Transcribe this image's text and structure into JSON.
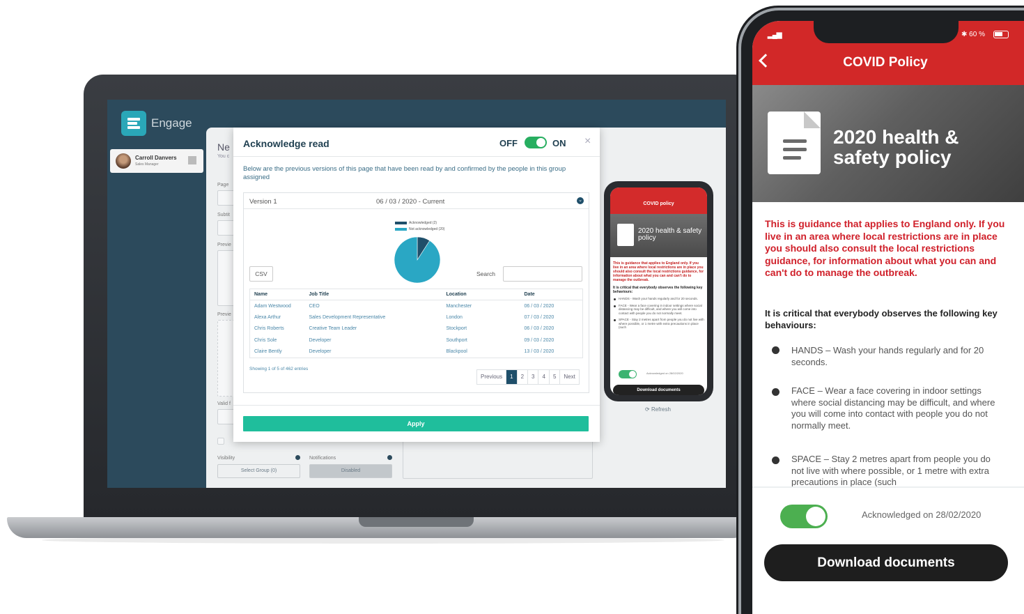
{
  "app": {
    "logo_text": "Engage",
    "user_name": "Carroll Danvers",
    "user_role": "Sales Manager",
    "bg_title": "Ne",
    "bg_sub": "You c",
    "bg_labels": [
      "Page",
      "Subtit",
      "Previe",
      "Previe",
      "Valid f"
    ],
    "visibility_label": "Visibility",
    "visibility_value": "Select Group (0)",
    "notifications_label": "Notifications",
    "notifications_value": "Disabled",
    "refresh_label": "Refresh"
  },
  "modal": {
    "title": "Acknowledge read",
    "toggle_off": "OFF",
    "toggle_on": "ON",
    "toggle_state": "on",
    "close": "×",
    "description": "Below are the previous versions of this page that have been read by and confirmed by the people in this group assigned",
    "version_name": "Version 1",
    "version_date": "06 / 03 / 2020 - Current",
    "csv_label": "CSV",
    "search_label": "Search",
    "search_value": "",
    "columns": [
      "Name",
      "Job Title",
      "Location",
      "Date"
    ],
    "rows": [
      [
        "Adam Westwood",
        "CEO",
        "Manchester",
        "06 / 03 / 2020"
      ],
      [
        "Alexa Arthur",
        "Sales Development Representative",
        "London",
        "07 / 03 / 2020"
      ],
      [
        "Chris Roberts",
        "Creative Team Leader",
        "Stockport",
        "06 / 03 / 2020"
      ],
      [
        "Chris Sole",
        "Developer",
        "Southport",
        "09 / 03 / 2020"
      ],
      [
        "Claire Bently",
        "Developer",
        "Blackpool",
        "13 / 03 / 2020"
      ]
    ],
    "showing": "Showing 1 of 5 of 462 entries",
    "pager": {
      "previous": "Previous",
      "pages": [
        "1",
        "2",
        "3",
        "4",
        "5"
      ],
      "active": "1",
      "next": "Next"
    },
    "apply_label": "Apply"
  },
  "chart_data": {
    "type": "pie",
    "labels": [
      "Acknowledged (2)",
      "Not acknowledged (20)"
    ],
    "values": [
      2,
      20
    ],
    "colors": [
      "#1f4f6a",
      "#2aa7c4"
    ]
  },
  "mini_phone": {
    "header": "COVID policy",
    "hero_title": "2020 health & safety policy",
    "red_text": "This is guidance that applies to England only. If you live in an area where local restrictions are in place you should also consult the local restrictions guidance, for information about what you can and can't do to manage the outbreak.",
    "critical": "It is critical that everybody observes the following key behaviours:",
    "bullets": [
      "HANDS - Wash your hands regularly and for 20 seconds.",
      "FACE - Wear a face covering in indoor settings where social distancing may be difficult, and where you will come into contact with people you do not normally meet.",
      "SPACE - Stay 2 metres apart from people you do not live with where possible, or 1 metre with extra precautions in place (such"
    ],
    "ack": "Acknowledged on 28/02/2020",
    "download": "Download documents"
  },
  "phone": {
    "battery": "60 %",
    "title": "COVID Policy",
    "hero_title": "2020 health & safety policy",
    "red_text": "This is guidance that applies to England only. If you live in an area where local restrictions are in place you should also consult the local restrictions guidance, for information about what you can and can't do to manage the outbreak.",
    "critical": "It is critical that everybody observes the following key behaviours:",
    "bullets": [
      "HANDS – Wash your hands regularly and for 20 seconds.",
      "FACE – Wear a face covering in indoor settings where social distancing may be difficult, and where you will come into contact with people you do not normally meet.",
      "SPACE – Stay 2 metres apart from people you do not live with where possible, or 1 metre with extra precautions in place (such"
    ],
    "ack_toggle_state": "on",
    "ack": "Acknowledged on 28/02/2020",
    "download": "Download documents"
  }
}
